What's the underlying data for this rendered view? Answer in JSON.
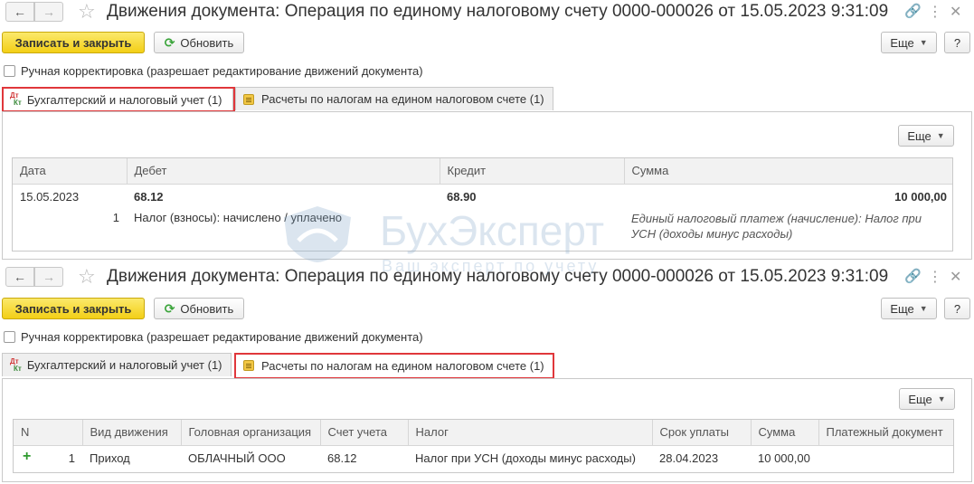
{
  "window_title": "Движения документа: Операция по единому налоговому счету 0000-000026 от 15.05.2023 9:31:09",
  "toolbar": {
    "save_close_label": "Записать и закрыть",
    "refresh_label": "Обновить",
    "more_label": "Еще",
    "help_label": "?"
  },
  "manual_check_label": "Ручная корректировка (разрешает редактирование движений документа)",
  "tabs": [
    {
      "label": "Бухгалтерский и налоговый учет (1)",
      "icon": "dt-kt-icon"
    },
    {
      "label": "Расчеты по налогам на едином налоговом счете (1)",
      "icon": "ledger-icon"
    }
  ],
  "dtkt_icon": {
    "top": "Дт",
    "bottom": "Кт"
  },
  "table_more_label": "Еще",
  "accounting_table": {
    "columns": [
      "Дата",
      "Дебет",
      "Кредит",
      "Сумма"
    ],
    "rows": [
      {
        "date": "15.05.2023",
        "debit": "68.12",
        "credit": "68.90",
        "sum": "10 000,00",
        "line_no": "1",
        "debit_sub": "Налог (взносы): начислено / уплачено",
        "content_line1": "Единый налоговый платеж (начисление): Налог при",
        "content_line2": "УСН (доходы минус расходы)"
      }
    ]
  },
  "tax_table": {
    "columns": [
      "N",
      "Вид движения",
      "Головная организация",
      "Счет учета",
      "Налог",
      "Срок уплаты",
      "Сумма",
      "Платежный документ"
    ],
    "rows": [
      {
        "marker": "+",
        "n": "1",
        "movement": "Приход",
        "organization": "ОБЛАЧНЫЙ ООО",
        "account": "68.12",
        "tax": "Налог при УСН (доходы минус расходы)",
        "due_date": "28.04.2023",
        "sum": "10 000,00",
        "payment_doc": ""
      }
    ]
  },
  "watermark": {
    "text": "БухЭксперт",
    "sub": "Ваш эксперт по учету"
  },
  "colors": {
    "primary_button": "#f3cf16",
    "highlight": "#e0373b",
    "plus": "#2e9a2e"
  }
}
